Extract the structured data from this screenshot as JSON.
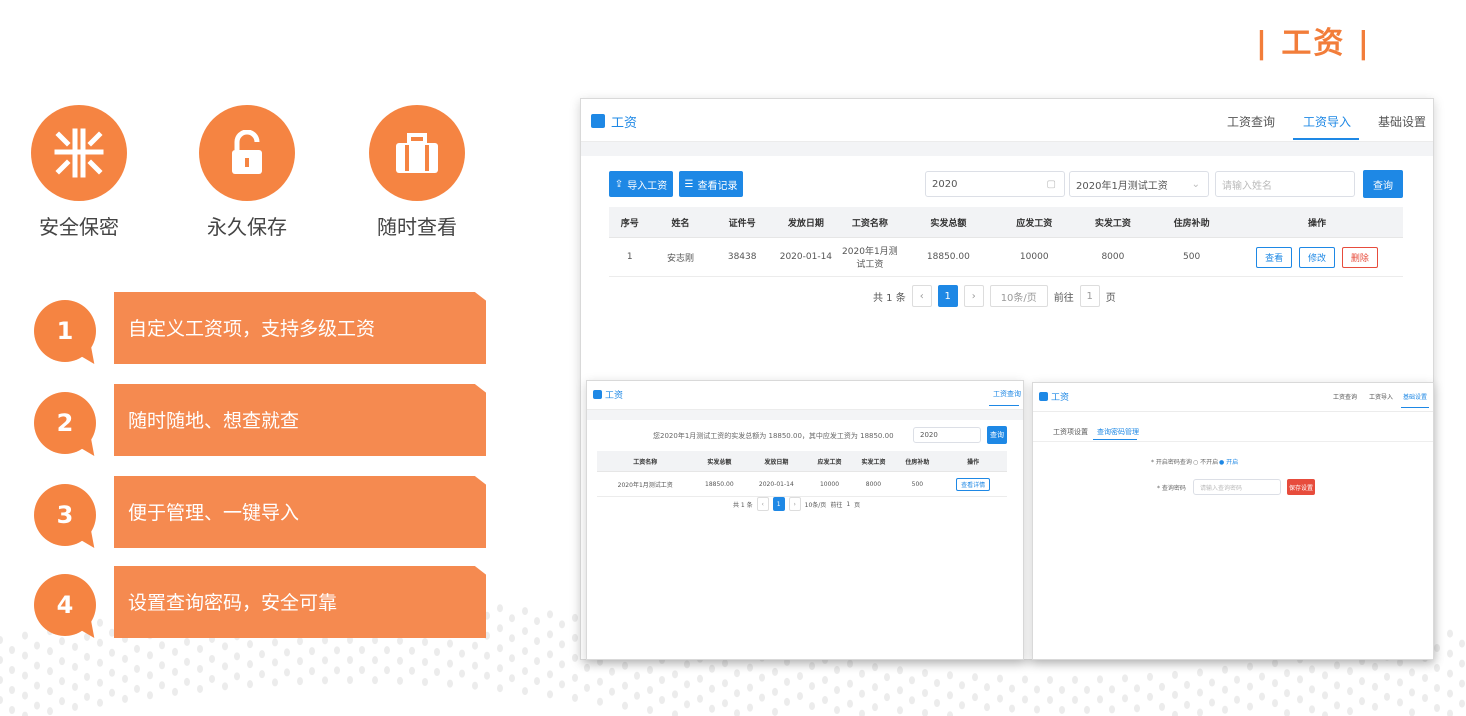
{
  "section_title": "| 工资 |",
  "features": [
    {
      "icon": "shield-bars-icon",
      "label": "安全保密"
    },
    {
      "icon": "unlock-icon",
      "label": "永久保存"
    },
    {
      "icon": "briefcase-icon",
      "label": "随时查看"
    }
  ],
  "items": [
    {
      "num": "1",
      "text": "自定义工资项，支持多级工资"
    },
    {
      "num": "2",
      "text": "随时随地、想查就查"
    },
    {
      "num": "3",
      "text": "便于管理、一键导入"
    },
    {
      "num": "4",
      "text": "设置查询密码，安全可靠"
    }
  ],
  "colors": {
    "accent": "#f58442",
    "primary": "#1e88e5",
    "danger": "#e74c3c"
  },
  "main_app": {
    "title": "工资",
    "nav": [
      "工资查询",
      "工资导入",
      "基础设置"
    ],
    "active_nav": "工资导入",
    "import_button": "导入工资",
    "record_button": "查看记录",
    "year_value": "2020",
    "batch_value": "2020年1月测试工资",
    "name_placeholder": "请输入姓名",
    "search_button": "查询",
    "table": {
      "headers": [
        "序号",
        "姓名",
        "证件号",
        "发放日期",
        "工资名称",
        "实发总额",
        "应发工资",
        "实发工资",
        "住房补助",
        "操作"
      ],
      "row": [
        "1",
        "安志刚",
        "38438",
        "2020-01-14",
        "2020年1月测试工资",
        "18850.00",
        "10000",
        "8000",
        "500"
      ],
      "actions": [
        "查看",
        "修改",
        "删除"
      ]
    },
    "pager": {
      "total": "共 1 条",
      "page": "1",
      "per_page": "10条/页",
      "goto": "前往",
      "goto_page": "1",
      "page_unit": "页"
    }
  },
  "sub_left": {
    "title": "工资",
    "nav_active": "工资查询",
    "summary": "您2020年1月测试工资的实发总额为 18850.00，其中应发工资为 18850.00",
    "year_value": "2020",
    "search_button": "查询",
    "table": {
      "headers": [
        "工资名称",
        "实发总额",
        "发放日期",
        "应发工资",
        "实发工资",
        "住房补助",
        "操作"
      ],
      "row": [
        "2020年1月测试工资",
        "18850.00",
        "2020-01-14",
        "10000",
        "8000",
        "500"
      ],
      "action": "查看详情"
    },
    "pager": {
      "total": "共 1 条",
      "page": "1",
      "per_page": "10条/页",
      "goto": "前往",
      "goto_page": "1",
      "page_unit": "页"
    }
  },
  "sub_right": {
    "title": "工资",
    "nav": [
      "工资查询",
      "工资导入",
      "基础设置"
    ],
    "tabs": [
      "工资项设置",
      "查询密码管理"
    ],
    "row1_label": "* 开启密码查询",
    "radio_off": "不开启",
    "radio_on": "开启",
    "row2_label": "* 查询密码",
    "password_placeholder": "请输入查询密码",
    "save_button": "保存设置"
  }
}
